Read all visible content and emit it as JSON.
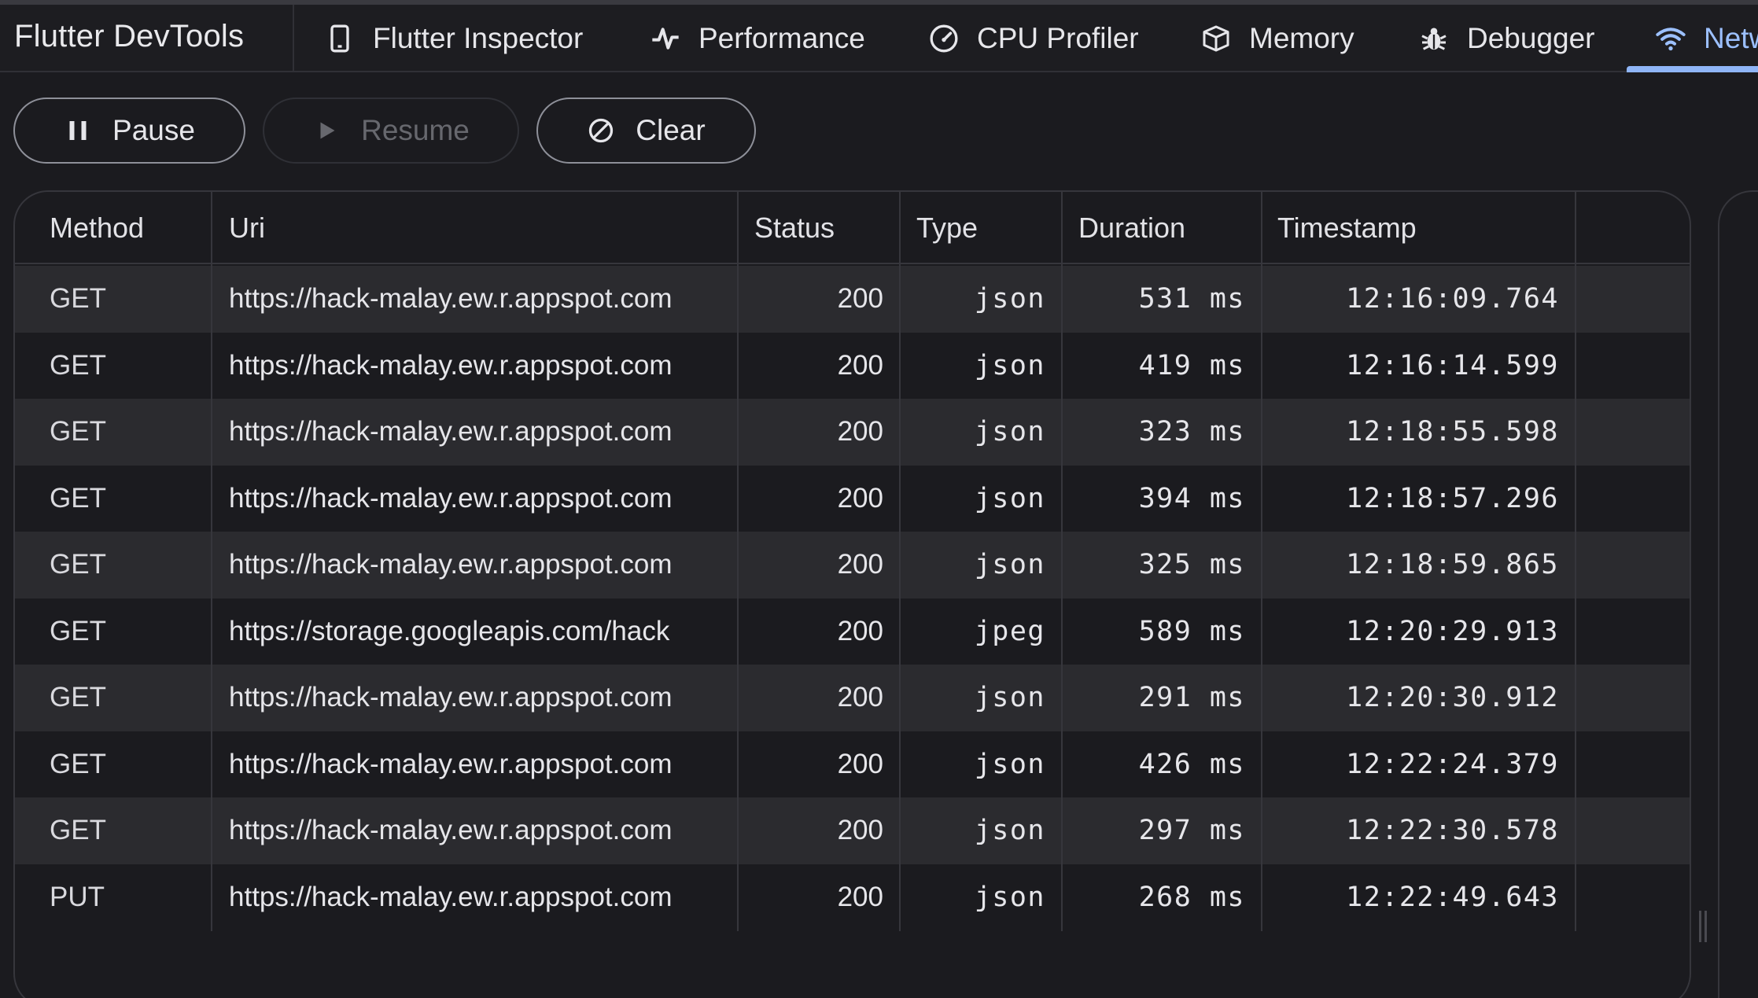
{
  "app": {
    "title": "Flutter DevTools"
  },
  "tabs": [
    {
      "label": "Flutter Inspector",
      "icon": "phone-icon"
    },
    {
      "label": "Performance",
      "icon": "pulse-icon"
    },
    {
      "label": "CPU Profiler",
      "icon": "gauge-icon"
    },
    {
      "label": "Memory",
      "icon": "box-icon"
    },
    {
      "label": "Debugger",
      "icon": "bug-icon"
    },
    {
      "label": "Netw",
      "icon": "wifi-icon",
      "active": true
    }
  ],
  "controls": {
    "pause_label": "Pause",
    "resume_label": "Resume",
    "clear_label": "Clear"
  },
  "table": {
    "columns": [
      "Method",
      "Uri",
      "Status",
      "Type",
      "Duration",
      "Timestamp"
    ],
    "rows": [
      {
        "method": "GET",
        "uri": "https://hack-malay.ew.r.appspot.com",
        "status": "200",
        "type": "json",
        "duration": "531 ms",
        "timestamp": "12:16:09.764"
      },
      {
        "method": "GET",
        "uri": "https://hack-malay.ew.r.appspot.com",
        "status": "200",
        "type": "json",
        "duration": "419 ms",
        "timestamp": "12:16:14.599"
      },
      {
        "method": "GET",
        "uri": "https://hack-malay.ew.r.appspot.com",
        "status": "200",
        "type": "json",
        "duration": "323 ms",
        "timestamp": "12:18:55.598"
      },
      {
        "method": "GET",
        "uri": "https://hack-malay.ew.r.appspot.com",
        "status": "200",
        "type": "json",
        "duration": "394 ms",
        "timestamp": "12:18:57.296"
      },
      {
        "method": "GET",
        "uri": "https://hack-malay.ew.r.appspot.com",
        "status": "200",
        "type": "json",
        "duration": "325 ms",
        "timestamp": "12:18:59.865"
      },
      {
        "method": "GET",
        "uri": "https://storage.googleapis.com/hack",
        "status": "200",
        "type": "jpeg",
        "duration": "589 ms",
        "timestamp": "12:20:29.913"
      },
      {
        "method": "GET",
        "uri": "https://hack-malay.ew.r.appspot.com",
        "status": "200",
        "type": "json",
        "duration": "291 ms",
        "timestamp": "12:20:30.912"
      },
      {
        "method": "GET",
        "uri": "https://hack-malay.ew.r.appspot.com",
        "status": "200",
        "type": "json",
        "duration": "426 ms",
        "timestamp": "12:22:24.379"
      },
      {
        "method": "GET",
        "uri": "https://hack-malay.ew.r.appspot.com",
        "status": "200",
        "type": "json",
        "duration": "297 ms",
        "timestamp": "12:22:30.578"
      },
      {
        "method": "PUT",
        "uri": "https://hack-malay.ew.r.appspot.com",
        "status": "200",
        "type": "json",
        "duration": "268 ms",
        "timestamp": "12:22:49.643"
      }
    ]
  },
  "colors": {
    "background": "#1b1b1f",
    "row_alt": "#2b2b2f",
    "accent": "#8fb5f7",
    "border": "#36363c"
  }
}
